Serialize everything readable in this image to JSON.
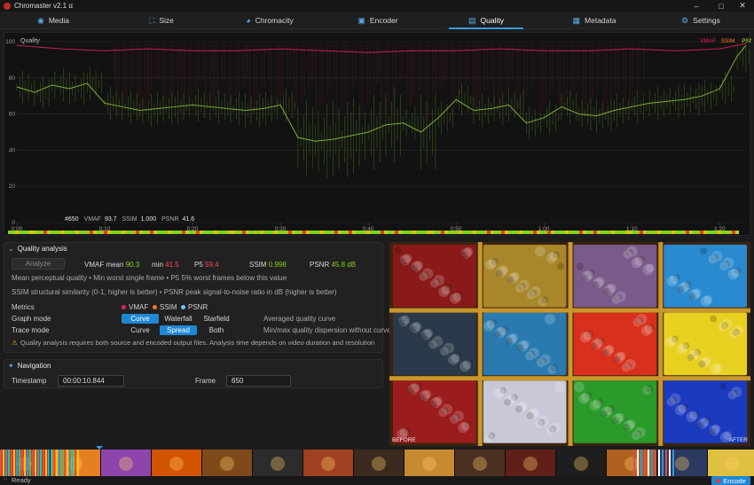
{
  "window": {
    "title": "Chromaster v2.1 α",
    "controls": {
      "minimize": "–",
      "maximize": "□",
      "close": "✕"
    }
  },
  "tabs": [
    {
      "label": "Media",
      "icon": "media-icon",
      "glyph": "◉",
      "active": false
    },
    {
      "label": "Size",
      "icon": "size-icon",
      "glyph": "⛶",
      "active": false
    },
    {
      "label": "Chromacity",
      "icon": "chroma-icon",
      "glyph": "◕",
      "active": false
    },
    {
      "label": "Encoder",
      "icon": "encoder-icon",
      "glyph": "▣",
      "active": false
    },
    {
      "label": "Quality",
      "icon": "quality-icon",
      "glyph": "▤",
      "active": true
    },
    {
      "label": "Metadata",
      "icon": "metadata-icon",
      "glyph": "▦",
      "active": false
    },
    {
      "label": "Settings",
      "icon": "settings-icon",
      "glyph": "⚙",
      "active": false
    }
  ],
  "chart_data": {
    "type": "line",
    "title": "Quality",
    "ylim": [
      0,
      100
    ],
    "yticks": [
      "100",
      "80",
      "60",
      "40",
      "20",
      "0"
    ],
    "xticks": [
      "0:00",
      "0:10",
      "0:20",
      "0:30",
      "0:40",
      "0:50",
      "1:00",
      "1:10",
      "1:20"
    ],
    "legend": [
      {
        "name": "VMAF",
        "color": "#e0245e"
      },
      {
        "name": "SSIM",
        "color": "#ff7a1a"
      },
      {
        "name": "PSNR",
        "color": "#b8e62e"
      }
    ],
    "series": [
      {
        "name": "PSNR",
        "color": "#8cc63f",
        "x": [
          0,
          2,
          4,
          6,
          8,
          10,
          12,
          14,
          16,
          18,
          20,
          22,
          24,
          26,
          28,
          30,
          32,
          34,
          36,
          38,
          40,
          42,
          44,
          46,
          48,
          50,
          52,
          54,
          56,
          58,
          60,
          62,
          64,
          66,
          68,
          70,
          72,
          74,
          76,
          78,
          80,
          82,
          83
        ],
        "values": [
          75,
          72,
          76,
          74,
          77,
          66,
          64,
          62,
          63,
          64,
          65,
          64,
          63,
          62,
          63,
          65,
          47,
          45,
          46,
          48,
          50,
          54,
          55,
          50,
          58,
          68,
          62,
          63,
          65,
          55,
          58,
          64,
          60,
          59,
          62,
          64,
          66,
          67,
          68,
          70,
          74,
          92,
          98
        ]
      },
      {
        "name": "VMAF",
        "color": "#e0245e",
        "x": [
          0,
          5,
          10,
          15,
          20,
          25,
          30,
          35,
          40,
          45,
          50,
          55,
          60,
          65,
          70,
          75,
          80,
          83
        ],
        "values": [
          98,
          96,
          95,
          96,
          95,
          95,
          96,
          95,
          94,
          95,
          95,
          96,
          95,
          95,
          96,
          95,
          96,
          99
        ]
      }
    ],
    "readout": {
      "frame": "#650",
      "vmaf_label": "VMAF",
      "vmaf": "93.7",
      "ssim_label": "SSIM",
      "ssim": "1.000",
      "psnr_label": "PSNR",
      "psnr": "41.6"
    }
  },
  "quality": {
    "header": "Quality analysis",
    "analyze_label": "Analyze",
    "vmaf_mean_label": "VMAF mean",
    "vmaf_mean": "90.3",
    "min_label": "min",
    "min": "41.5",
    "p5_label": "P5",
    "p5": "59.4",
    "ssim_label": "SSIM",
    "ssim": "0.998",
    "psnr_label": "PSNR",
    "psnr": "45.8 dB",
    "desc1": "Mean perceptual quality • Min worst single frame • P5 5% worst frames below this value",
    "desc2": "SSIM structural similarity (0-1, higher is better) • PSNR peak signal-to-noise ratio in dB (higher is better)",
    "metrics_label": "Metrics",
    "metrics": [
      {
        "label": "VMAF",
        "color": "#e0245e"
      },
      {
        "label": "SSIM",
        "color": "#ff7a1a"
      },
      {
        "label": "PSNR",
        "color": "#6ec6ff"
      }
    ],
    "graph_mode_label": "Graph mode",
    "graph_modes": [
      "Curve",
      "Waterfall",
      "Starfield"
    ],
    "graph_mode_hint": "Averaged quality curve",
    "trace_mode_label": "Trace mode",
    "trace_modes": [
      "Curve",
      "Spread",
      "Both"
    ],
    "trace_mode_hint": "Min/max quality dispersion without curve",
    "warning": "Quality analysis requires both source and encoded output files. Analysis time depends on video duration and resolution"
  },
  "navigation": {
    "header": "Navigation",
    "timestamp_label": "Timestamp",
    "timestamp": "00:00:10.844",
    "frame_label": "Frame",
    "frame": "650"
  },
  "preview": {
    "before_label": "BEFORE",
    "after_label": "AFTER"
  },
  "status": {
    "text": "Ready",
    "encode_label": "Encode"
  }
}
